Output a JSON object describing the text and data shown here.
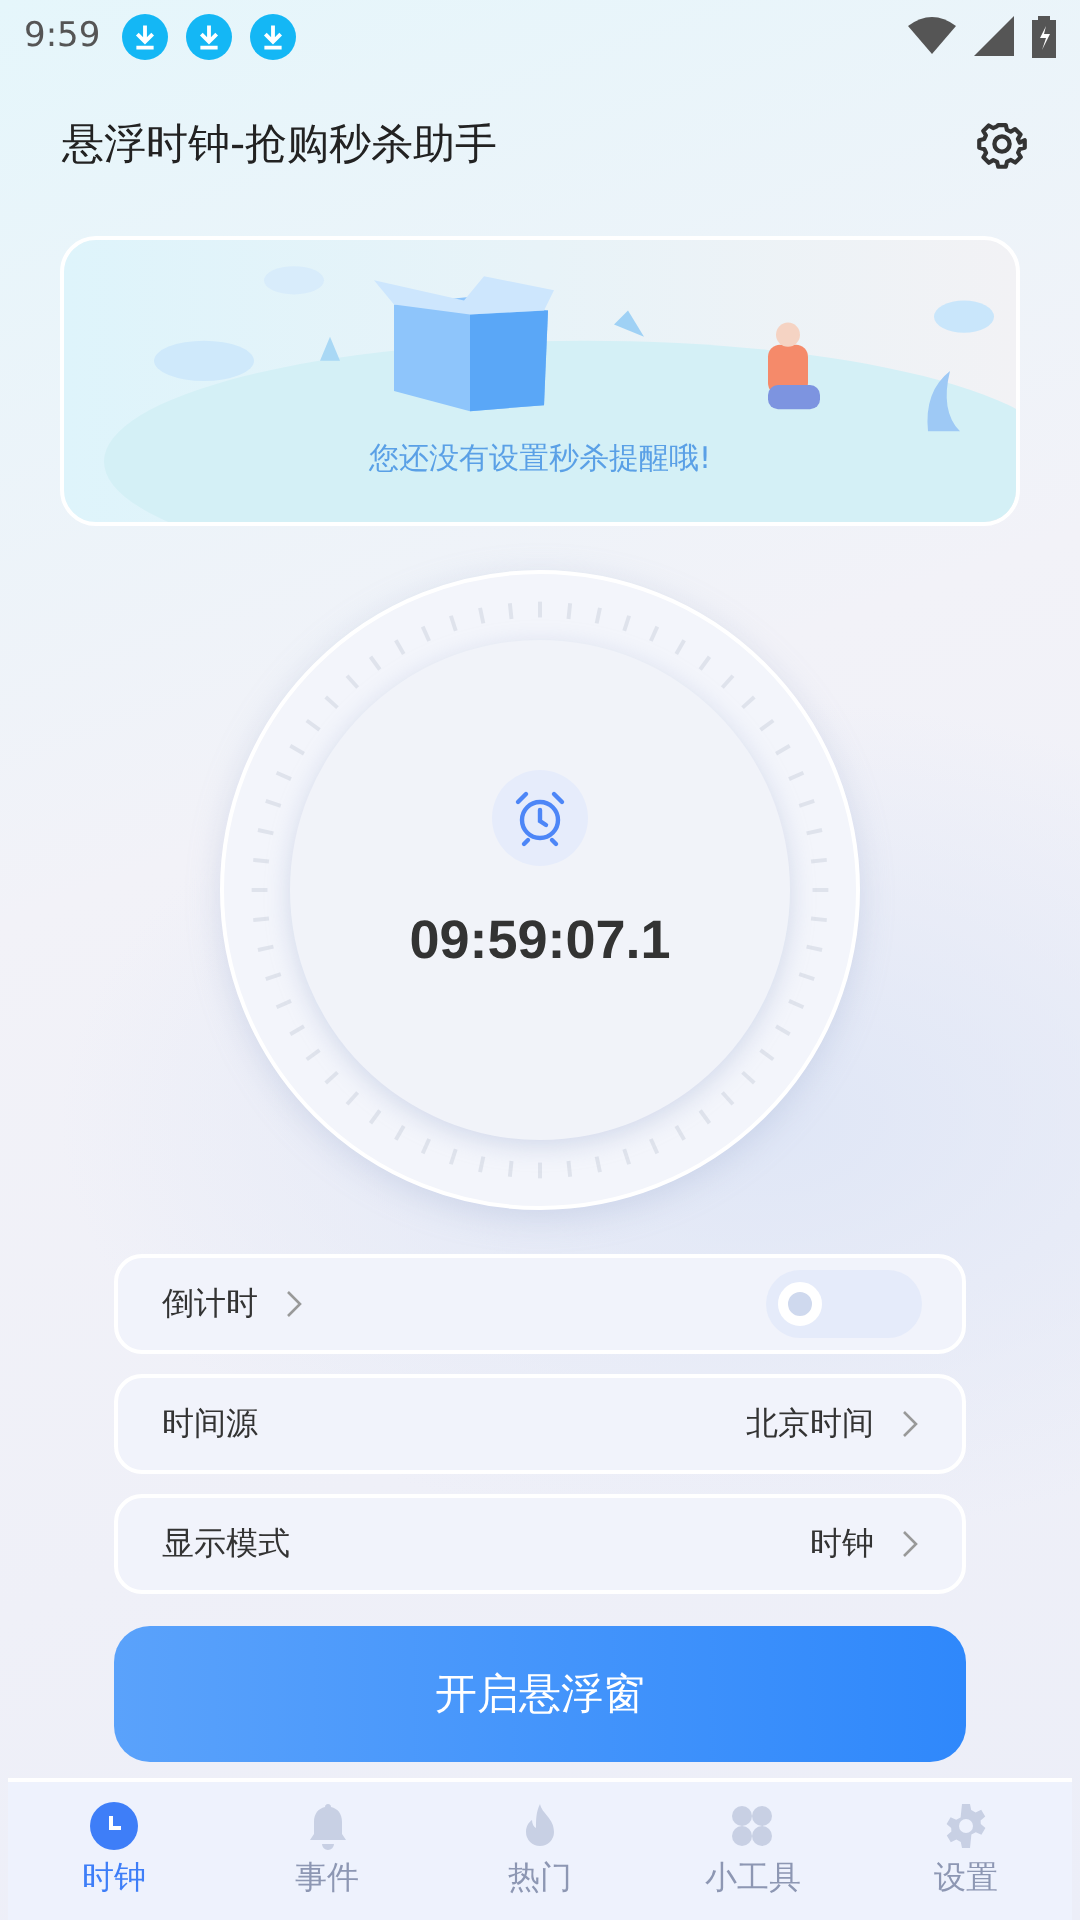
{
  "status_bar": {
    "time": "9:59"
  },
  "header": {
    "title": "悬浮时钟-抢购秒杀助手"
  },
  "banner": {
    "message": "您还没有设置秒杀提醒哦!"
  },
  "clock": {
    "time": "09:59:07.1"
  },
  "settings": [
    {
      "kind": "toggle",
      "label": "倒计时",
      "on": false
    },
    {
      "kind": "select",
      "label": "时间源",
      "value": "北京时间"
    },
    {
      "kind": "select",
      "label": "显示模式",
      "value": "时钟"
    }
  ],
  "primary_button": "开启悬浮窗",
  "tabs": [
    {
      "label": "时钟",
      "kind": "clock",
      "selected": true
    },
    {
      "label": "事件",
      "kind": "bell",
      "selected": false
    },
    {
      "label": "热门",
      "kind": "flame",
      "selected": false
    },
    {
      "label": "小工具",
      "kind": "grid",
      "selected": false
    },
    {
      "label": "设置",
      "kind": "gear",
      "selected": false
    }
  ]
}
